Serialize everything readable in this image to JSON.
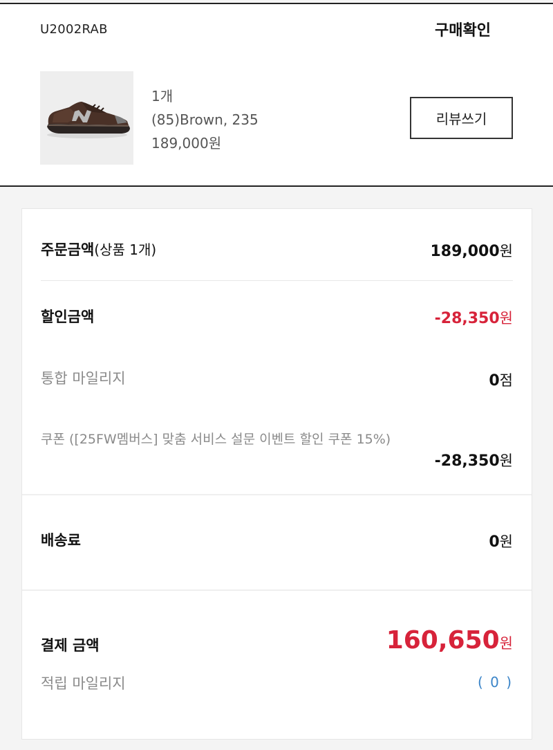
{
  "order": {
    "product_code": "U2002RAB",
    "confirm_label": "구매확인"
  },
  "product": {
    "quantity": "1개",
    "option": "(85)Brown, 235",
    "price": "189,000원",
    "review_label": "리뷰쓰기",
    "thumbnail_icon": "sneaker-image"
  },
  "summary": {
    "order_amount": {
      "label": "주문금액",
      "sub": "(상품 1개)",
      "value": "189,000",
      "unit": "원"
    },
    "discount": {
      "label": "할인금액",
      "value": "-28,350",
      "unit": "원"
    },
    "mileage": {
      "label": "통합 마일리지",
      "value": "0",
      "unit": "점"
    },
    "coupon": {
      "label": "쿠폰 ([25FW멤버스] 맞춤 서비스 설문 이벤트 할인 쿠폰 15%)",
      "value": "-28,350",
      "unit": "원"
    },
    "shipping": {
      "label": "배송료",
      "value": "0",
      "unit": "원"
    },
    "total": {
      "label": "결제 금액",
      "value": "160,650",
      "unit": "원"
    },
    "earned_mileage": {
      "label": "적립 마일리지",
      "value": "( 0 )"
    }
  },
  "colors": {
    "accent_red": "#d7233a",
    "link_blue": "#3a84c8"
  }
}
